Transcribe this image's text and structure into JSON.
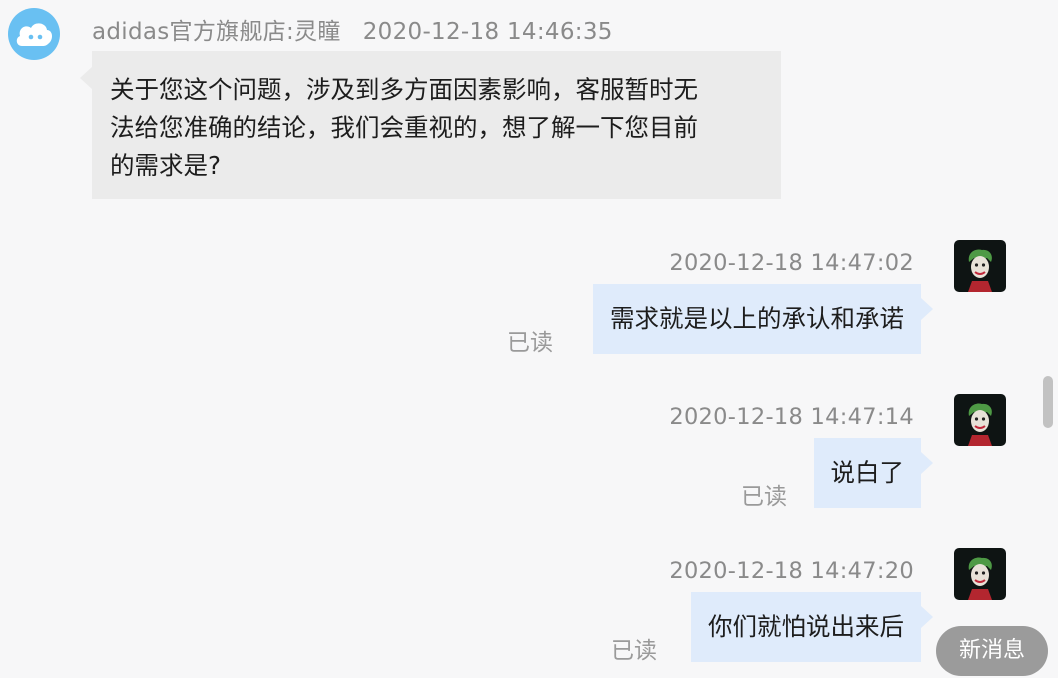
{
  "incoming": {
    "sender": "adidas官方旗舰店:灵瞳",
    "time": "2020-12-18 14:46:35",
    "text_lines": [
      "关于您这个问题，涉及到多方面因素影响，客服暂时无",
      "法给您准确的结论，我们会重视的，想了解一下您目前",
      "的需求是?"
    ]
  },
  "outgoing": [
    {
      "time": "2020-12-18 14:47:02",
      "text": "需求就是以上的承认和承诺",
      "status": "已读"
    },
    {
      "time": "2020-12-18 14:47:14",
      "text": "说白了",
      "status": "已读"
    },
    {
      "time": "2020-12-18 14:47:20",
      "text": "你们就怕说出来后",
      "status": "已读"
    }
  ],
  "new_message_button": "新消息",
  "icons": {
    "shop_avatar": "cloud-face-avatar-icon",
    "user_avatar": "joker-avatar-icon"
  },
  "colors": {
    "incoming_bubble": "#ebebeb",
    "outgoing_bubble": "#dfebfb",
    "shop_avatar": "#69c0f2",
    "new_message_pill": "#9b9b9b"
  }
}
